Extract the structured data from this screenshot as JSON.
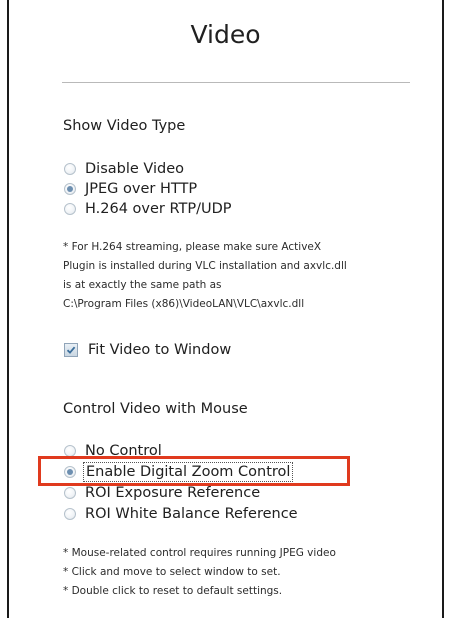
{
  "page": {
    "title": "Video"
  },
  "video_type": {
    "heading": "Show Video Type",
    "options": [
      {
        "label": "Disable Video",
        "checked": false
      },
      {
        "label": "JPEG over HTTP",
        "checked": true
      },
      {
        "label": "H.264 over RTP/UDP",
        "checked": false
      }
    ],
    "note_lines": [
      "* For H.264 streaming, please make sure ActiveX",
      "Plugin is installed during VLC installation and axvlc.dll",
      "is at exactly the same path as",
      "C:\\Program Files (x86)\\VideoLAN\\VLC\\axvlc.dll"
    ]
  },
  "fit_video": {
    "label": "Fit Video to Window",
    "checked": true
  },
  "mouse_control": {
    "heading": "Control Video with Mouse",
    "options": [
      {
        "label": "No Control",
        "checked": false
      },
      {
        "label": "Enable Digital Zoom Control",
        "checked": true
      },
      {
        "label": "ROI Exposure Reference",
        "checked": false
      },
      {
        "label": "ROI White Balance Reference",
        "checked": false
      }
    ],
    "note_lines": [
      "* Mouse-related control requires running JPEG video",
      "* Click and move to select window to set.",
      "* Double click to reset to default settings."
    ]
  },
  "colors": {
    "highlight": "#e03a1e",
    "radio_dot": "#6d8fb0"
  }
}
